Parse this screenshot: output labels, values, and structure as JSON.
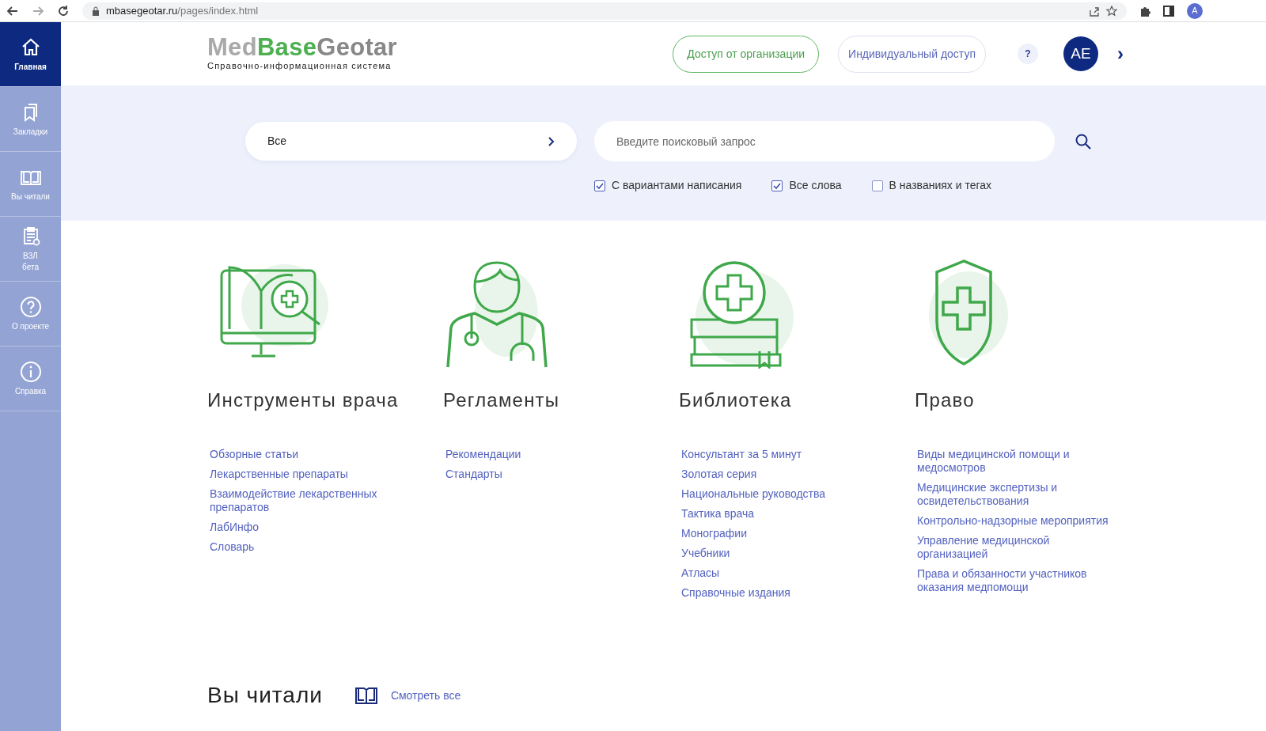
{
  "browser": {
    "url_host": "mbasegeotar.ru",
    "url_path": "/pages/index.html",
    "profile": "A"
  },
  "sidebar": {
    "items": [
      {
        "label": "Главная",
        "kind": "home",
        "selected": true
      },
      {
        "label": "Закладки",
        "kind": "bookmarks",
        "selected": false
      },
      {
        "label": "Вы читали",
        "kind": "book",
        "selected": false
      },
      {
        "label": "ВЗЛ\nбета",
        "kind": "clipboard",
        "selected": false
      },
      {
        "label": "О проекте",
        "kind": "question",
        "selected": false
      },
      {
        "label": "Справка",
        "kind": "info",
        "selected": false
      }
    ]
  },
  "header": {
    "logo": {
      "part_1": "Med",
      "part_2": "Base",
      "part_3": "Geotar",
      "subtitle": "Справочно-информационная система"
    },
    "buttons": [
      {
        "label": "Доступ от организации",
        "kind": "green"
      },
      {
        "label": "Индивидуальный доступ",
        "kind": "outline"
      }
    ],
    "help": "?",
    "avatar": "AE",
    "chevron": "›"
  },
  "search": {
    "scope": "Все",
    "placeholder": "Введите поисковый запрос",
    "options": [
      {
        "label": "С вариантами написания",
        "checked": true
      },
      {
        "label": "Все слова",
        "checked": true
      },
      {
        "label": "В названиях и тегах",
        "checked": false
      }
    ]
  },
  "categories": [
    {
      "title": "Инструменты врача",
      "links": [
        "Обзорные статьи",
        "Лекарственные препараты",
        "Взаимодействие лекарственных препаратов",
        "ЛабИнфо",
        "Словарь"
      ]
    },
    {
      "title": "Регламенты",
      "links": [
        "Рекомендации",
        "Стандарты"
      ]
    },
    {
      "title": "Библиотека",
      "links": [
        "Консультант за 5 минут",
        "Золотая серия",
        "Национальные руководства",
        "Тактика врача",
        "Монографии",
        "Учебники",
        "Атласы",
        "Справочные издания"
      ]
    },
    {
      "title": "Право",
      "links": [
        "Виды медицинской помощи и медосмотров",
        "Медицинские экспертизы и освидетельствования",
        "Контрольно-надзорные мероприятия",
        "Управление медицинской организацией",
        "Права и обязанности участников оказания медпомощи"
      ]
    }
  ],
  "recent": {
    "title": "Вы читали",
    "link": "Смотреть все"
  }
}
